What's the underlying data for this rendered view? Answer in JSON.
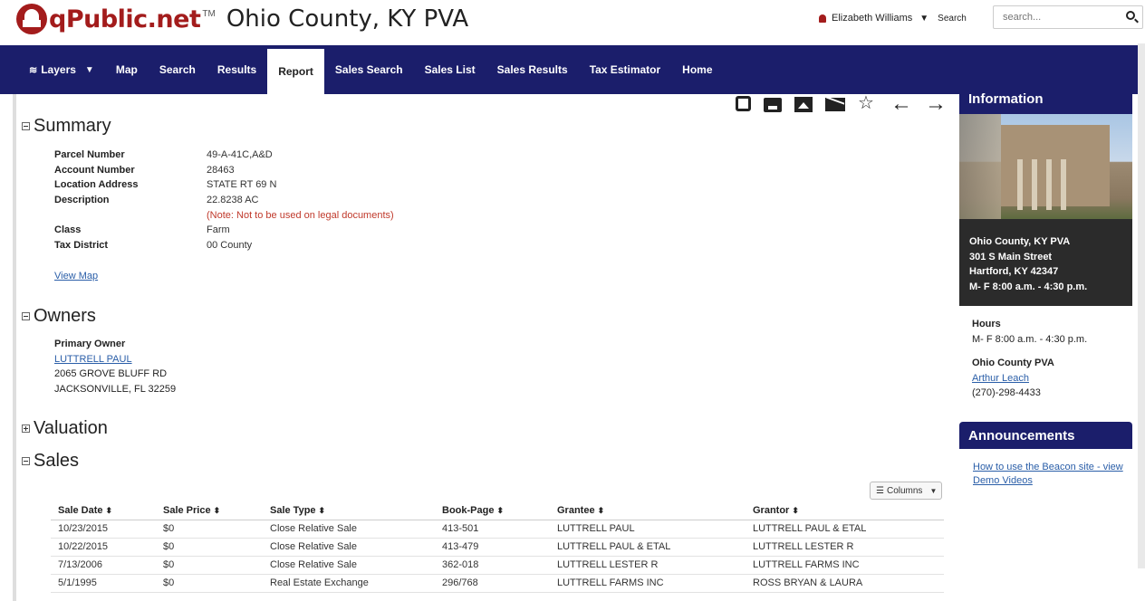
{
  "header": {
    "logo_text": "qPublic.net",
    "logo_tm": "TM",
    "county_title": "Ohio County, KY PVA",
    "user_name": "Elizabeth Williams",
    "search_label": "Search",
    "search_placeholder": "search..."
  },
  "nav": {
    "items": [
      "Layers",
      "Map",
      "Search",
      "Results",
      "Report",
      "Sales Search",
      "Sales List",
      "Sales Results",
      "Tax Estimator",
      "Home"
    ],
    "active": "Report"
  },
  "summary": {
    "title": "Summary",
    "rows": [
      {
        "k": "Parcel Number",
        "v": "49-A-41C,A&D"
      },
      {
        "k": "Account Number",
        "v": "28463"
      },
      {
        "k": "Location Address",
        "v": "STATE RT 69 N"
      },
      {
        "k": "Description",
        "v": "22.8238 AC"
      },
      {
        "k": "",
        "v": "(Note: Not to be used on legal documents)"
      },
      {
        "k": "Class",
        "v": "Farm"
      },
      {
        "k": "Tax District",
        "v": "00 County"
      }
    ],
    "view_map": "View Map"
  },
  "owners": {
    "title": "Owners",
    "label": "Primary Owner",
    "name": "LUTTRELL PAUL",
    "address1": "2065 GROVE BLUFF RD",
    "address2": "JACKSONVILLE, FL 32259"
  },
  "valuation": {
    "title": "Valuation"
  },
  "sales": {
    "title": "Sales",
    "columns_button": "Columns",
    "headers": [
      "Sale Date",
      "Sale Price",
      "Sale Type",
      "Book-Page",
      "Grantee",
      "Grantor"
    ],
    "rows": [
      [
        "10/23/2015",
        "$0",
        "Close Relative Sale",
        "413-501",
        "LUTTRELL PAUL",
        "LUTTRELL PAUL & ETAL"
      ],
      [
        "10/22/2015",
        "$0",
        "Close Relative Sale",
        "413-479",
        "LUTTRELL PAUL & ETAL",
        "LUTTRELL LESTER R"
      ],
      [
        "7/13/2006",
        "$0",
        "Close Relative Sale",
        "362-018",
        "LUTTRELL LESTER R",
        "LUTTRELL FARMS INC"
      ],
      [
        "5/1/1995",
        "$0",
        "Real Estate Exchange",
        "296/768",
        "LUTTRELL FARMS INC",
        "ROSS BRYAN & LAURA"
      ]
    ]
  },
  "sidebar": {
    "info_title": "Information",
    "office_name": "Ohio County, KY PVA",
    "street": "301 S Main Street",
    "city": "Hartford, KY 42347",
    "hours_line": "M- F 8:00 a.m. - 4:30 p.m.",
    "hours_title": "Hours",
    "hours_value": "M- F 8:00 a.m. - 4:30 p.m.",
    "pva_title": "Ohio County PVA",
    "pva_name": "Arthur Leach",
    "pva_phone": "(270)-298-4433",
    "announcements_title": "Announcements",
    "announcement_link": "How to use the Beacon site - view Demo Videos"
  },
  "colors": {
    "brand_red": "#a31c1c",
    "nav_blue": "#1b1e6b",
    "link_blue": "#2a5ea8",
    "note_red": "#c0392b"
  }
}
